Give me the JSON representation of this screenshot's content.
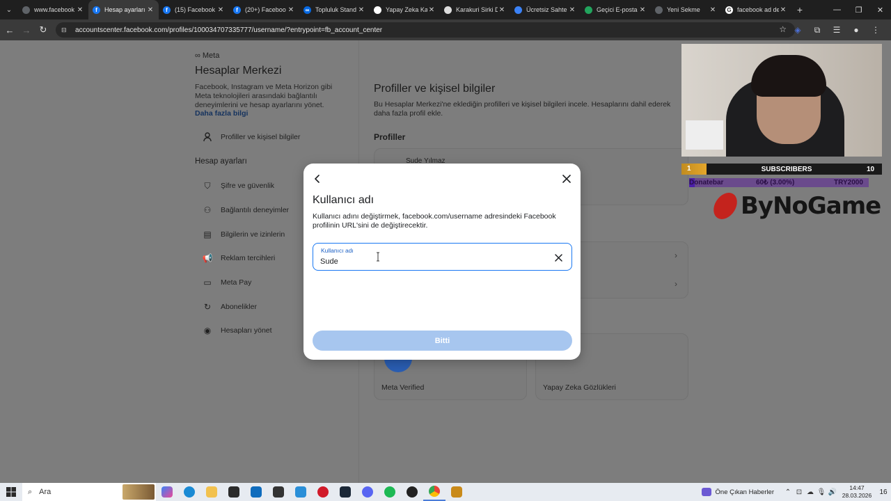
{
  "browser": {
    "tabs": [
      {
        "title": "www.facebook",
        "fav_color": "#5f6368",
        "fav_glyph": "",
        "active": false
      },
      {
        "title": "Hesap ayarları",
        "fav_color": "#1877f2",
        "fav_glyph": "f",
        "active": true
      },
      {
        "title": "(15) Facebook",
        "fav_color": "#1877f2",
        "fav_glyph": "f",
        "active": false
      },
      {
        "title": "(20+) Faceboo",
        "fav_color": "#1877f2",
        "fav_glyph": "f",
        "active": false
      },
      {
        "title": "Topluluk Stand",
        "fav_color": "#0668e1",
        "fav_glyph": "∞",
        "active": false
      },
      {
        "title": "Yapay Zeka Ka",
        "fav_color": "#ffffff",
        "fav_glyph": "",
        "active": false
      },
      {
        "title": "Karakuri Sirki D",
        "fav_color": "#dddddd",
        "fav_glyph": "",
        "active": false
      },
      {
        "title": "Ücretsiz Sahte",
        "fav_color": "#3b82f6",
        "fav_glyph": "",
        "active": false
      },
      {
        "title": "Geçici E-posta",
        "fav_color": "#22a45d",
        "fav_glyph": "",
        "active": false
      },
      {
        "title": "Yeni Sekme",
        "fav_color": "#5f6368",
        "fav_glyph": "",
        "active": false
      },
      {
        "title": "facebook ad de",
        "fav_color": "#ffffff",
        "fav_glyph": "G",
        "active": false
      }
    ],
    "url": "accountscenter.facebook.com/profiles/100034707335777/username/?entrypoint=fb_account_center"
  },
  "sidebar": {
    "brand": "∞ Meta",
    "title": "Hesaplar Merkezi",
    "description": "Facebook, Instagram ve Meta Horizon gibi Meta teknolojileri arasındaki bağlantılı deneyimlerini ve hesap ayarlarını yönet.",
    "more_link": "Daha fazla bilgi",
    "profiles_item": "Profiller ve kişisel bilgiler",
    "settings_heading": "Hesap ayarları",
    "items": [
      {
        "label": "Şifre ve güvenlik",
        "icon": "shield-icon"
      },
      {
        "label": "Bağlantılı deneyimler",
        "icon": "people-icon"
      },
      {
        "label": "Bilgilerin ve izinlerin",
        "icon": "document-icon"
      },
      {
        "label": "Reklam tercihleri",
        "icon": "megaphone-icon"
      },
      {
        "label": "Meta Pay",
        "icon": "card-icon"
      },
      {
        "label": "Abonelikler",
        "icon": "refresh-icon"
      },
      {
        "label": "Hesapları yönet",
        "icon": "user-circle-icon"
      }
    ]
  },
  "main": {
    "title": "Profiller ve kişisel bilgiler",
    "description": "Bu Hesaplar Merkezi'ne eklediğin profilleri ve kişisel bilgileri incele. Hesaplarını dahil ederek daha fazla profil ekle.",
    "profiles_heading": "Profiller",
    "profile_name": "Sude Yılmaz",
    "cards": [
      "Meta Verified",
      "Yapay Zeka Gözlükleri"
    ]
  },
  "modal": {
    "title": "Kullanıcı adı",
    "description": "Kullanıcı adını değiştirmek, facebook.com/username adresindeki Facebook profilinin URL'sini de değiştirecektir.",
    "field_label": "Kullanıcı adı",
    "field_value": "Sude",
    "done_label": "Bitti"
  },
  "stream_overlay": {
    "subscribers_count": "1",
    "subscribers_label": "SUBSCRIBERS",
    "subscribers_goal": "10",
    "donate_name": "Donatebar",
    "donate_amount": "60₺ (3.00%)",
    "donate_goal": "TRY2000",
    "donate_progress": 0.03,
    "brand": "ByNoGame"
  },
  "taskbar": {
    "search_placeholder": "Ara",
    "news_label": "Öne Çıkan Haberler",
    "time": "14:47",
    "date": "28.03.2026",
    "notification_count": "16"
  }
}
